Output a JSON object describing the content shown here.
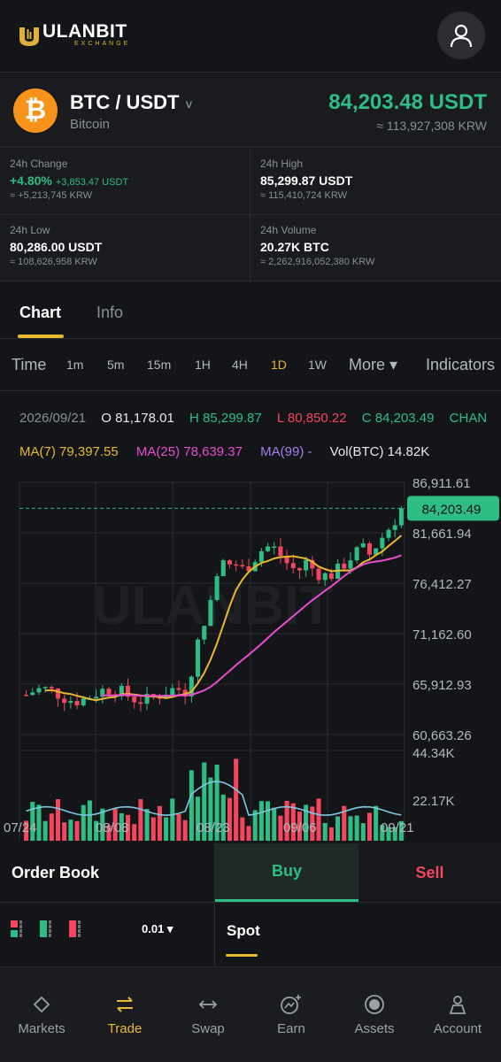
{
  "header": {
    "logo_text": "ULANBIT",
    "logo_sub": "EXCHANGE",
    "profile_icon": "user-icon"
  },
  "pair": {
    "name": "BTC / USDT",
    "caret": "v",
    "coin_name": "Bitcoin",
    "coin_symbol": "₿",
    "price": "84,203.48 USDT",
    "price_krw": "≈ 113,927,308 KRW"
  },
  "stats": {
    "change_label": "24h Change",
    "change_pct": "+4.80%",
    "change_abs": "+3,853.47 USDT",
    "change_krw": "≈ +5,213,745 KRW",
    "high_label": "24h High",
    "high_value": "85,299.87 USDT",
    "high_krw": "≈ 115,410,724 KRW",
    "low_label": "24h Low",
    "low_value": "80,286.00 USDT",
    "low_krw": "≈ 108,626,958 KRW",
    "volume_label": "24h Volume",
    "volume_value": "20.27K BTC",
    "volume_krw": "≈ 2,262,916,052,380 KRW"
  },
  "tabs": [
    {
      "label": "Chart",
      "active": true
    },
    {
      "label": "Info",
      "active": false
    }
  ],
  "timeframes": {
    "time_label": "Time",
    "items": [
      "1m",
      "5m",
      "15m",
      "1H",
      "4H",
      "1D",
      "1W"
    ],
    "active": "1D",
    "more_label": "More ▾",
    "indicators_label": "Indicators"
  },
  "ohlc": {
    "date": "2026/09/21",
    "open": "O 81,178.01",
    "high": "H 85,299.87",
    "low": "L 80,850.22",
    "close": "C 84,203.49",
    "change": "CHAN"
  },
  "ma": {
    "ma7": "MA(7) 79,397.55",
    "ma25": "MA(25) 78,639.37",
    "ma99": "MA(99) -",
    "vol": "Vol(BTC) 14.82K"
  },
  "chart_data": {
    "type": "candlestick",
    "watermark": "ULANBIT",
    "price_axis": [
      "86,911.61",
      "81,661.94",
      "76,412.27",
      "71,162.60",
      "65,912.93",
      "60,663.26"
    ],
    "current_price_label": "84,203.49",
    "volume_axis": [
      "44.34K",
      "22.17K"
    ],
    "date_axis": [
      "07/24",
      "08/08",
      "08/23",
      "09/06",
      "09/21"
    ],
    "ylim": [
      60663.26,
      86911.61
    ],
    "colors": {
      "up": "#2ebd85",
      "down": "#f6465d",
      "ma7": "#e8b92e",
      "ma25": "#e84ccf",
      "vol_ma": "#7ec8e3"
    }
  },
  "order": {
    "book_title": "Order Book",
    "buy_label": "Buy",
    "sell_label": "Sell",
    "depth": "0.01 ▾",
    "spot_label": "Spot"
  },
  "nav": [
    {
      "label": "Markets",
      "icon": "diamond-icon",
      "active": false
    },
    {
      "label": "Trade",
      "icon": "swap-arrows-icon",
      "active": true
    },
    {
      "label": "Swap",
      "icon": "double-arrow-icon",
      "active": false
    },
    {
      "label": "Earn",
      "icon": "earn-icon",
      "active": false
    },
    {
      "label": "Assets",
      "icon": "assets-icon",
      "active": false
    },
    {
      "label": "Account",
      "icon": "account-icon",
      "active": false
    }
  ]
}
